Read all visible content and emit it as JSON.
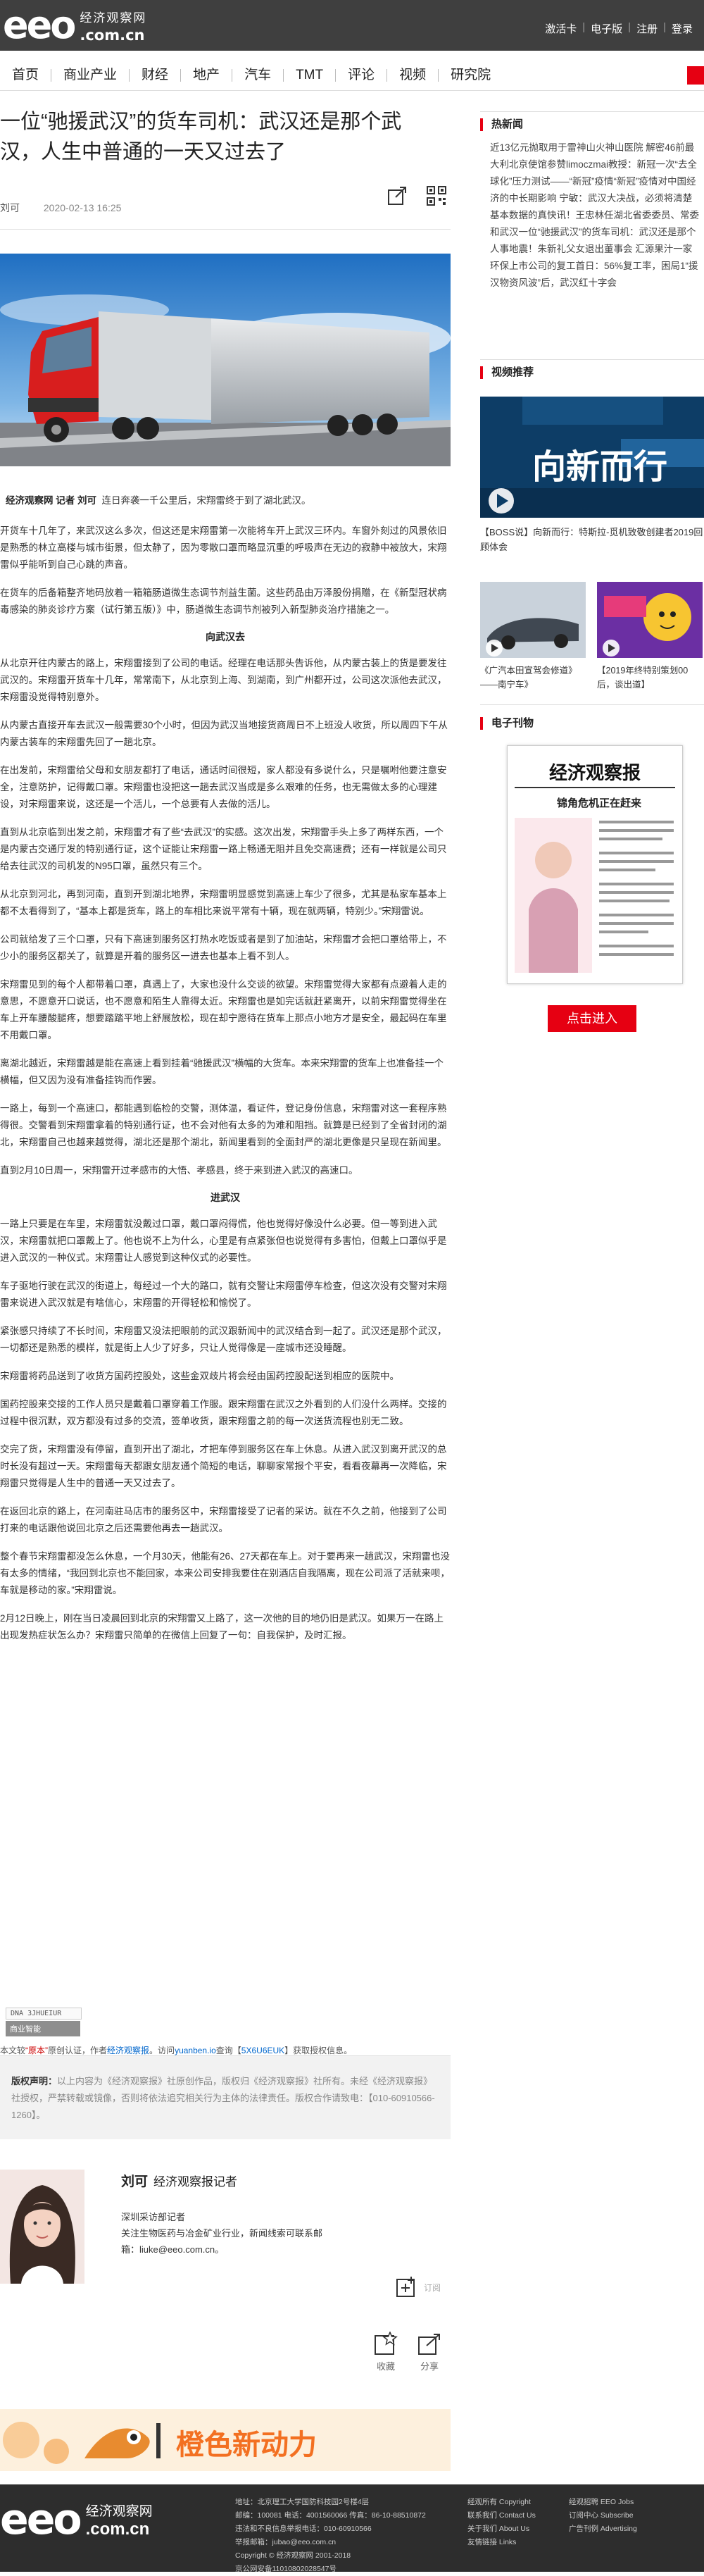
{
  "header": {
    "logo_main": "eeo",
    "logo_cn": "经济观察网",
    "logo_domain": ".com.cn",
    "links": [
      "激活卡",
      "电子版",
      "注册",
      "登录"
    ]
  },
  "nav": [
    "首页",
    "商业产业",
    "财经",
    "地产",
    "汽车",
    "TMT",
    "评论",
    "视频",
    "研究院"
  ],
  "article": {
    "title": "一位“驰援武汉”的货车司机：武汉还是那个武汉，人生中普通的一天又过去了",
    "author": "刘可",
    "date": "2020-02-13 16:25",
    "lead_bold": "经济观察网 记者 刘可",
    "lead": "连日奔袭一千公里后，宋翔雷终于到了湖北武汉。",
    "paragraphs": [
      {
        "type": "p",
        "text": "开货车十几年了，来武汉这么多次，但这还是宋翔雷第一次能将车开上武汉三环内。车窗外刻过的风景依旧是熟悉的林立高楼与城市街景，但太静了，因为零散口罩而略显沉重的呼吸声在无边的寂静中被放大，宋翔雷似乎能听到自己心跳的声音。"
      },
      {
        "type": "p",
        "text": "在货车的后备箱整齐地码放着一箱箱肠道微生态调节剂益生菌。这些药品由万泽股份捐赠，在《新型冠状病毒感染的肺炎诊疗方案（试行第五版）》中，肠道微生态调节剂被列入新型肺炎治疗措施之一。"
      },
      {
        "type": "h",
        "text": "向武汉去"
      },
      {
        "type": "p",
        "text": "从北京开往内蒙古的路上，宋翔雷接到了公司的电话。经理在电话那头告诉他，从内蒙古装上的货是要发往武汉的。宋翔雷开货车十几年，常常南下，从北京到上海、到湖南，到广州都开过，公司这次派他去武汉，宋翔雷没觉得特别意外。"
      },
      {
        "type": "p",
        "text": "从内蒙古直接开车去武汉一般需要30个小时，但因为武汉当地接货商周日不上班没人收货，所以周四下午从内蒙古装车的宋翔雷先回了一趟北京。"
      },
      {
        "type": "p",
        "text": "在出发前，宋翔雷给父母和女朋友都打了电话，通话时间很短，家人都没有多说什么，只是嘱咐他要注意安全，注意防护，记得戴口罩。宋翔雷也没把这一趟去武汉当成是多么艰难的任务，也无需做太多的心理建设，对宋翔雷来说，这还是一个活儿，一个总要有人去做的活儿。"
      },
      {
        "type": "p",
        "text": "直到从北京临到出发之前，宋翔雷才有了些“去武汉”的实感。这次出发，宋翔雷手头上多了两样东西，一个是内蒙古交通厅发的特别通行证，这个证能让宋翔雷一路上畅通无阻并且免交高速费；还有一样就是公司只给去往武汉的司机发的N95口罩，虽然只有三个。"
      },
      {
        "type": "p",
        "text": "从北京到河北，再到河南，直到开到湖北地界，宋翔雷明显感觉到高速上车少了很多，尤其是私家车基本上都不太看得到了，“基本上都是货车，路上的车相比来说平常有十辆，现在就两辆，特别少。”宋翔雷说。"
      },
      {
        "type": "p",
        "text": "公司就给发了三个口罩，只有下高速到服务区打热水吃饭或者是到了加油站，宋翔雷才会把口罩给带上，不少小的服务区都关了，就算是开着的服务区一进去也基本上看不到人。"
      },
      {
        "type": "p",
        "text": "宋翔雷见到的每个人都带着口罩，真遇上了，大家也没什么交谈的欲望。宋翔雷觉得大家都有点避着人走的意思，不愿意开口说话，也不愿意和陌生人靠得太近。宋翔雷也是如完话就赶紧离开，以前宋翔雷觉得坐在车上开车腰酸腿疼，想要踏踏平地上舒展放松，现在却宁愿待在货车上那点小地方才是安全，最起码在车里不用戴口罩。"
      },
      {
        "type": "p",
        "text": "离湖北越近，宋翔雷越是能在高速上看到挂着“驰援武汉”横幅的大货车。本来宋翔雷的货车上也准备挂一个横幅，但又因为没有准备挂钩而作罢。"
      },
      {
        "type": "p",
        "text": "一路上，每到一个高速口，都能遇到临检的交警，测体温，看证件，登记身份信息，宋翔雷对这一套程序熟得很。交警看到宋翔雷拿着的特别通行证，也不会对他有太多的为难和阻挡。就算是已经到了全省封闭的湖北，宋翔雷自己也越来越觉得，湖北还是那个湖北，新闻里看到的全面封严的湖北更像是只呈现在新闻里。"
      },
      {
        "type": "p",
        "text": "直到2月10日周一，宋翔雷开过孝感市的大悟、孝感县，终于来到进入武汉的高速口。"
      },
      {
        "type": "h",
        "text": "进武汉"
      },
      {
        "type": "p",
        "text": "一路上只要是在车里，宋翔雷就没戴过口罩，戴口罩闷得慌，他也觉得好像没什么必要。但一等到进入武汉，宋翔雷就把口罩戴上了。他也说不上为什么，心里是有点紧张但也说觉得有多害怕，但戴上口罩似乎是进入武汉的一种仪式。宋翔雷让人感觉到这种仪式的必要性。"
      },
      {
        "type": "p",
        "text": "车子驱地行驶在武汉的街道上，每经过一个大的路口，就有交警让宋翔雷停车检查，但这次没有交警对宋翔雷来说进入武汉就是有啥信心，宋翔雷的开得轻松和愉悦了。"
      },
      {
        "type": "p",
        "text": "紧张感只持续了不长时间，宋翔雷又没法把眼前的武汉跟新闻中的武汉结合到一起了。武汉还是那个武汉，一切都还是熟悉的模样，就是街上人少了好多，只让人觉得像是一座城市还没睡醒。"
      },
      {
        "type": "p",
        "text": "宋翔雷将药品送到了收货方国药控股处，这些金双歧片将会经由国药控股配送到相应的医院中。"
      },
      {
        "type": "p",
        "text": "国药控股来交接的工作人员只是戴着口罩穿着工作服。跟宋翔雷在武汉之外看到的人们没什么两样。交接的过程中很沉默，双方都没有过多的交流，签单收货，跟宋翔雷之前的每一次送货流程也别无二致。"
      },
      {
        "type": "p",
        "text": "交完了货，宋翔雷没有停留，直到开出了湖北，才把车停到服务区在车上休息。从进入武汉到离开武汉的总时长没有超过一天。宋翔雷每天都跟女朋友通个简短的电话，聊聊家常报个平安，看看夜幕再一次降临，宋翔雷只觉得是人生中的普通一天又过去了。"
      },
      {
        "type": "p",
        "text": "在返回北京的路上，在河南驻马店市的服务区中，宋翔雷接受了记者的采访。就在不久之前，他接到了公司打来的电话跟他说回北京之后还需要他再去一趟武汉。"
      },
      {
        "type": "p",
        "text": "整个春节宋翔雷都没怎么休息，一个月30天，他能有26、27天都在车上。对于要再来一趟武汉，宋翔雷也没有太多的情绪，“我回到北京也不能回家，本来公司安排我要住在别酒店自我隔离，现在公司派了活就来呗，车就是移动的家。”宋翔雷说。"
      },
      {
        "type": "p",
        "text": "2月12日晚上，刚在当日凌晨回到北京的宋翔雷又上路了，这一次他的目的地仍旧是武汉。如果万一在路上出现发热症状怎么办？宋翔雷只简单的在微信上回复了一句：自我保护，及时汇报。"
      }
    ]
  },
  "dna": {
    "code": "DNA 3JHUEIUR",
    "button": "商业智能"
  },
  "copyline": {
    "pre": "本文较",
    "red": "“原本”",
    "mid": "原创认证，作者",
    "link1": "经济观察报",
    "mid2": "。访问",
    "link2": "yuanben.io",
    "mid3": "查询【",
    "link3": "5X6U6EUK",
    "post": "】获取授权信息。"
  },
  "declaration": {
    "label": "版权声明：",
    "text": "以上内容为《经济观察报》社原创作品，版权归《经济观察报》社所有。未经《经济观察报》社授权，严禁转载或镜像，否则将依法追究相关行为主体的法律责任。版权合作请致电：【010-60910566-1260】。"
  },
  "author": {
    "name": "刘可",
    "role": "经济观察报记者",
    "dept": "深圳采访部记者",
    "focus": "关注生物医药与冶金矿业行业，新闻线索可联系邮",
    "email": "箱：liuke@eeo.com.cn。",
    "follow": "订阅"
  },
  "actions": {
    "favorite": "收藏",
    "share": "分享"
  },
  "banner": {
    "text": "橙色新动力"
  },
  "sidebar": {
    "hot_title": "热新闻",
    "hot_text": "近13亿元抛取用于雷神山火神山医院 解密46前最大利北京使馆参赞limoczmai教授：新冠一次“去全球化”压力测试——“新冠”疫情“新冠”疫情对中国经济的中长期影响  宁敏：武汉大决战，必须将清楚基本数据的真快讯！王忠林任湖北省委委员、常委和武汉一位“驰援武汉”的货车司机：武汉还是那个人事地震！朱新礼父女退出董事会 汇源果汁一家环保上市公司的复工首日：56%复工率，困局1“援汉物资风波”后，武汉红十字会",
    "video_title": "视频推荐",
    "video_main_text": "向新而行",
    "video_main_caption": "【BOSS说】向新而行：特斯拉-觅机致敬创建者2019回顾体会",
    "video_small": [
      {
        "caption": "《广汽本田宣驾会修道》——南宁车》"
      },
      {
        "caption": "【2019年终特别策划00后，谈出道】"
      }
    ],
    "paper_title": "电子刊物",
    "paper_name": "经济观察报",
    "paper_headline": "锦角危机正在赶来",
    "enter": "点击进入"
  },
  "footer": {
    "logo_main": "eeo",
    "logo_cn": "经济观察网",
    "logo_domain": ".com.cn",
    "col1": [
      "地址：北京理工大学国防科技园2号楼4层",
      "邮编：100081  电话：4001560066 传真：86-10-88510872",
      "违法和不良信息举报电话：010-60910566",
      "举报邮箱：jubao@eeo.com.cn",
      "Copyright © 经济观察网 2001-2018",
      "京公网安备11010802028547号"
    ],
    "col2": [
      "经观所有 Copyright",
      "联系我们 Contact Us",
      "关于我们 About Us",
      "友情链接 Links"
    ],
    "col3": [
      "经观招聘 EEO Jobs",
      "订阅中心 Subscribe",
      "广告刊例 Advertising"
    ]
  }
}
